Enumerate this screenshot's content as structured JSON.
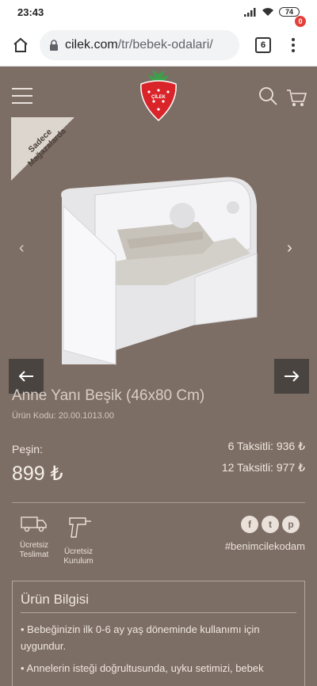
{
  "status_bar": {
    "time": "23:43",
    "battery": "74"
  },
  "browser": {
    "url_domain": "cilek.com",
    "url_path": "/tr/bebek-odalari/",
    "tab_count": "6"
  },
  "header": {
    "logo_text": "ÇİLEK",
    "cart_count": "0"
  },
  "ribbon": {
    "text": "Sadece Mağazalarda"
  },
  "product": {
    "title": "Anne Yanı Beşik (46x80 Cm)",
    "code": "Ürün Kodu: 20.00.1013.00",
    "cash_label": "Peşin:",
    "cash_price": "899 ₺",
    "installment_6": "6 Taksitli: 936 ₺",
    "installment_12": "12 Taksitli: 977 ₺"
  },
  "features": [
    {
      "icon": "truck-icon",
      "label": "Ücretsiz Teslimat"
    },
    {
      "icon": "drill-icon",
      "label": "Ücretsiz Kurulum"
    }
  ],
  "social": {
    "facebook": "f",
    "twitter": "t",
    "pinterest": "p",
    "hashtag": "#benimcilekodam"
  },
  "info": {
    "title": "Ürün Bilgisi",
    "items": [
      "Bebeğinizin ilk 0-6 ay yaş döneminde kullanımı için uygundur.",
      "Annelerin isteği doğrultusunda, uyku setimizi, bebek"
    ]
  },
  "colors": {
    "page_background": "#7d6e65",
    "arrow_button": "#494440",
    "logo_red": "#d9252a",
    "logo_green": "#3aa14a"
  }
}
